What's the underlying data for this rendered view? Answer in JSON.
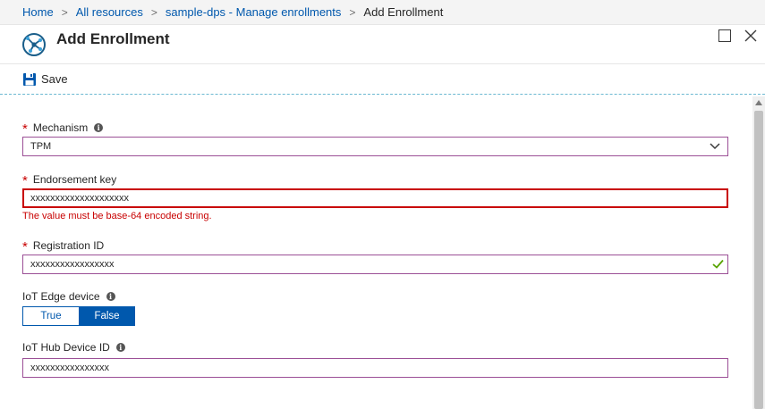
{
  "breadcrumb": {
    "items": [
      "Home",
      "All resources",
      "sample-dps - Manage enrollments"
    ],
    "current": "Add Enrollment",
    "separator": ">"
  },
  "blade": {
    "title": "Add Enrollment",
    "icon": "dps-icon",
    "window_controls": [
      "maximize-icon",
      "close-icon"
    ]
  },
  "toolbar": {
    "save_label": "Save",
    "save_icon": "floppy-disk-icon"
  },
  "colors": {
    "accent": "#0058ad",
    "error": "#c80000",
    "input_border": "#9b4f96",
    "success": "#57a300"
  },
  "form": {
    "mechanism": {
      "required_mark": "*",
      "label": "Mechanism",
      "info": "i",
      "value": "TPM"
    },
    "endorsement_key": {
      "required_mark": "*",
      "label": "Endorsement key",
      "value": "xxxxxxxxxxxxxxxxxxxx",
      "error": "The value must be base-64 encoded string."
    },
    "registration_id": {
      "required_mark": "*",
      "label": "Registration ID",
      "value": "xxxxxxxxxxxxxxxxx",
      "valid": true
    },
    "iot_edge": {
      "label": "IoT Edge device",
      "info": "i",
      "true_label": "True",
      "false_label": "False",
      "selected": "False"
    },
    "hub_device_id": {
      "label": "IoT Hub Device ID",
      "info": "i",
      "value": "xxxxxxxxxxxxxxxx"
    }
  }
}
